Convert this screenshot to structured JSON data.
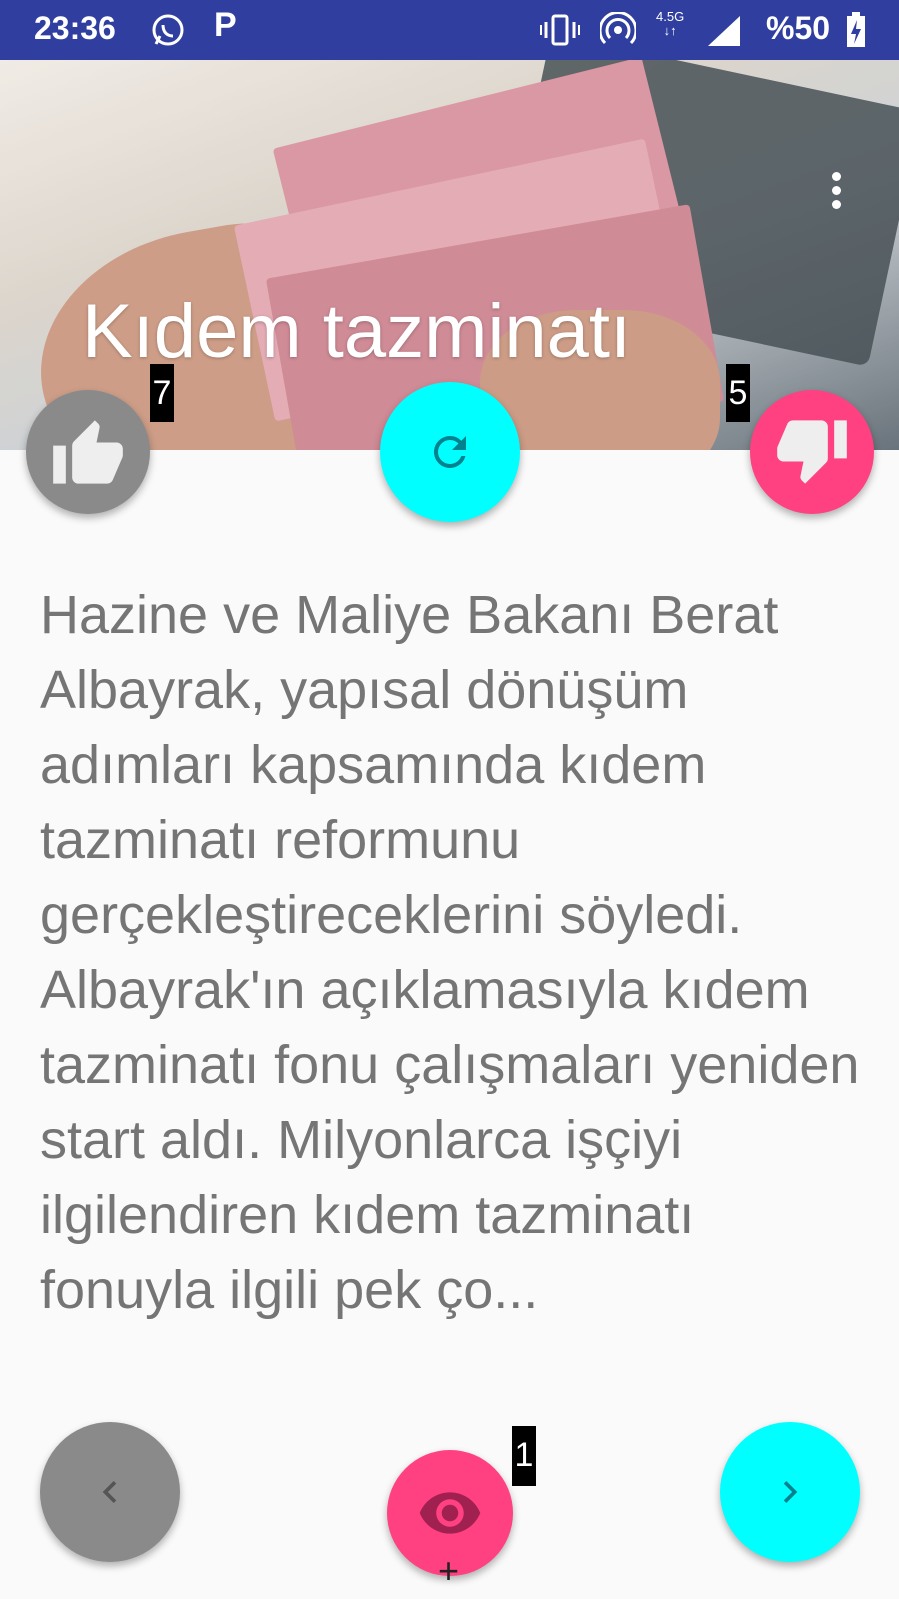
{
  "status_bar": {
    "time": "23:36",
    "notification_icons": [
      "whatsapp-icon",
      "parking-icon"
    ],
    "parking_glyph": "P",
    "network_type": "4.5G",
    "battery_text": "%50"
  },
  "header": {
    "title": "Kıdem tazminatı",
    "menu_icon": "more-vert-icon"
  },
  "actions": {
    "like_count": "7",
    "dislike_count": "5",
    "views_count": "1",
    "views_plus": "+"
  },
  "article": {
    "body": "Hazine ve Maliye Bakanı Berat Albayrak, yapısal dönüşüm adımları kapsamında kıdem tazminatı reformunu gerçekleştireceklerini söyledi. Albayrak'ın açıklamasıyla kıdem tazminatı fonu çalışmaları yeniden start aldı. Milyonlarca işçiyi ilgilendiren kıdem tazminatı fonuyla ilgili pek ço..."
  },
  "colors": {
    "status_bar": "#303f9f",
    "cyan_fab": "#00ffff",
    "pink_fab": "#ff4081",
    "grey_fab": "#8a8a8a",
    "body_text": "#757575"
  }
}
